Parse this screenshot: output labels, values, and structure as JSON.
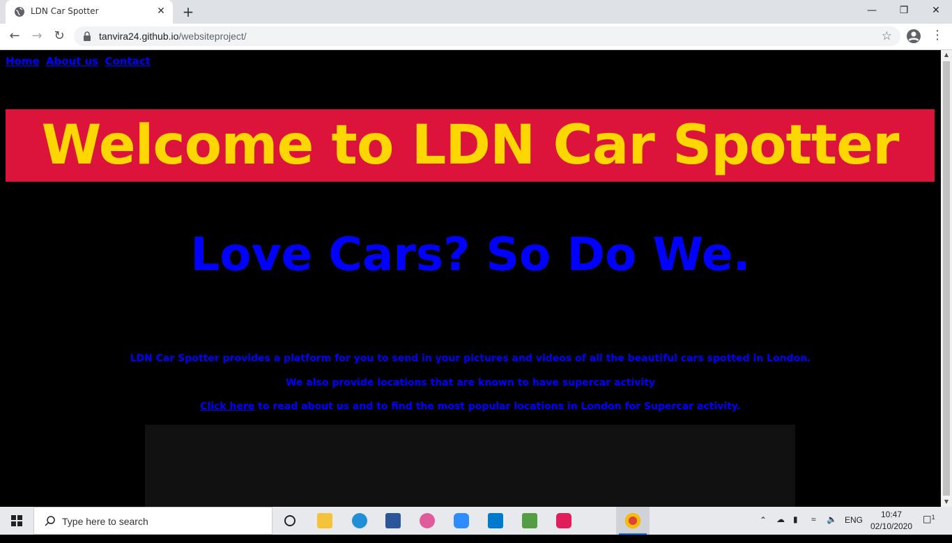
{
  "browser": {
    "tab_title": "LDN Car Spotter",
    "tab_close": "✕",
    "new_tab": "+",
    "url_host": "tanvira24.github.io",
    "url_path": "/websiteproject/",
    "minimize": "—",
    "restore": "❐",
    "close": "✕"
  },
  "page": {
    "nav": [
      "Home",
      "About us",
      "Contact"
    ],
    "banner_title": "Welcome to LDN Car Spotter",
    "tagline": "Love Cars? So Do We.",
    "para1": "LDN Car Spotter provides a platform for you to send in your pictures and videos of all the beautiful cars spotted in London.",
    "para2": "We also provide locations that are known to have supercar activity",
    "para3_link": "Click here",
    "para3_rest": " to read about us and to find the most popular locations in London for Supercar activity.",
    "colors": {
      "background": "#000000",
      "banner": "#dc143c",
      "banner_text": "#ffd700",
      "text": "#0000ff"
    }
  },
  "taskbar": {
    "search_placeholder": "Type here to search",
    "language": "ENG",
    "time": "10:47",
    "date": "02/10/2020",
    "notification_count": "1",
    "apps": [
      "cortana-icon",
      "file-explorer-icon",
      "edge-icon",
      "word-icon",
      "itunes-icon",
      "zoom-icon",
      "vscode-icon",
      "nodejs-icon",
      "slack-icon",
      "chrome-icon"
    ]
  }
}
